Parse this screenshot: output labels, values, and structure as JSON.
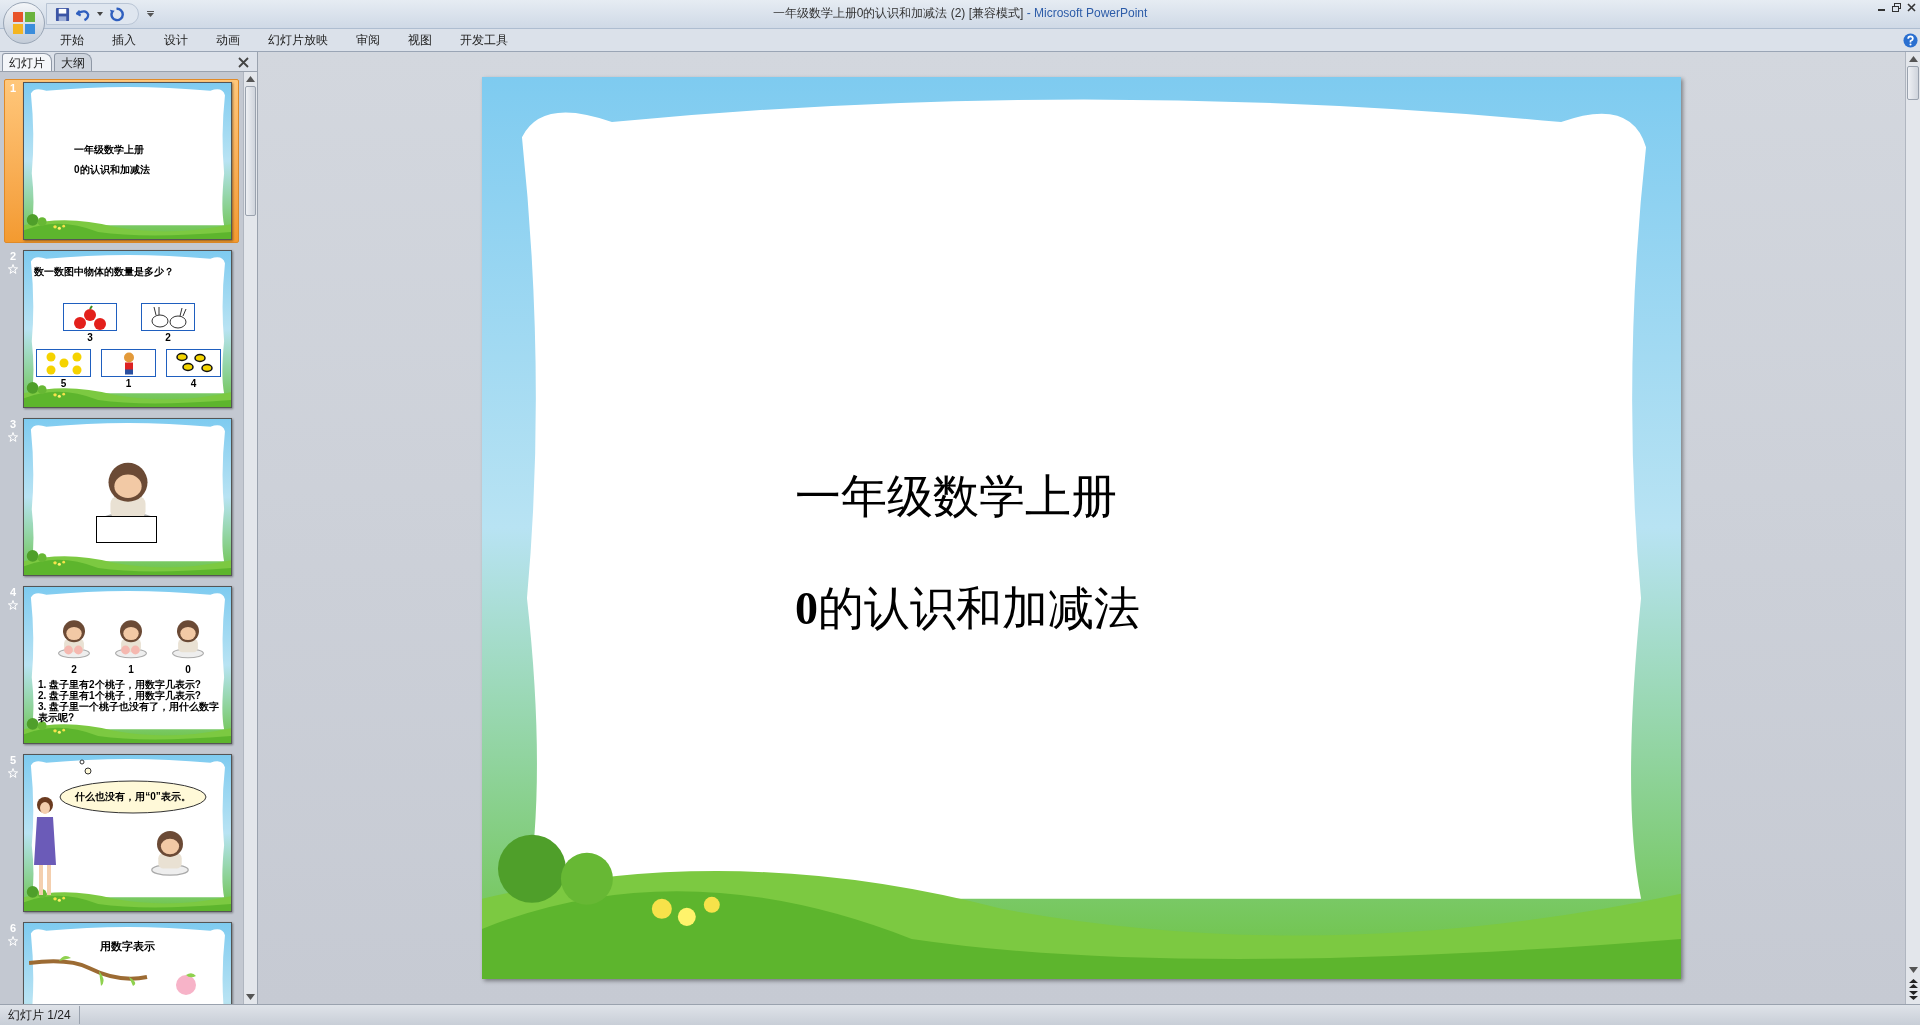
{
  "window": {
    "title": "一年级数学上册0的认识和加减法 (2) [兼容模式]",
    "app": "- Microsoft PowerPoint"
  },
  "ribbon_tabs": [
    {
      "label": "开始"
    },
    {
      "label": "插入"
    },
    {
      "label": "设计"
    },
    {
      "label": "动画"
    },
    {
      "label": "幻灯片放映"
    },
    {
      "label": "审阅"
    },
    {
      "label": "视图"
    },
    {
      "label": "开发工具"
    }
  ],
  "panel_tabs": [
    {
      "label": "幻灯片",
      "selected": true
    },
    {
      "label": "大纲",
      "selected": false
    }
  ],
  "slides": [
    {
      "number": "1",
      "selected": true,
      "animated": false,
      "kind": "title",
      "lines": [
        "一年级数学上册",
        "0的认识和加减法"
      ]
    },
    {
      "number": "2",
      "selected": false,
      "animated": true,
      "kind": "count",
      "title": "数一数图中物体的数量是多少？",
      "items": [
        {
          "kind": "apples",
          "label": "3"
        },
        {
          "kind": "rabbits",
          "label": "2"
        },
        {
          "kind": "flowers",
          "label": "5"
        },
        {
          "kind": "figure",
          "label": "1"
        },
        {
          "kind": "bees",
          "label": "4"
        }
      ]
    },
    {
      "number": "3",
      "selected": false,
      "animated": true,
      "kind": "monkey"
    },
    {
      "number": "4",
      "selected": false,
      "animated": true,
      "kind": "questions",
      "labels": [
        "2",
        "1",
        "0"
      ],
      "questions": [
        "1. 盘子里有2个桃子，用数字几表示?",
        "2. 盘子里有1个桃子，用数字几表示?",
        "3. 盘子里一个桃子也没有了，用什么数字表示呢?"
      ]
    },
    {
      "number": "5",
      "selected": false,
      "animated": true,
      "kind": "speech",
      "bubble": "什么也没有，用“0”表示。"
    },
    {
      "number": "6",
      "selected": false,
      "animated": true,
      "kind": "heading",
      "title": "用数字表示"
    }
  ],
  "main_slide": {
    "lines": [
      "一年级数学上册",
      "**0**的认识和加减法"
    ]
  },
  "status_bar": {
    "text": "幻灯片 1/24"
  }
}
